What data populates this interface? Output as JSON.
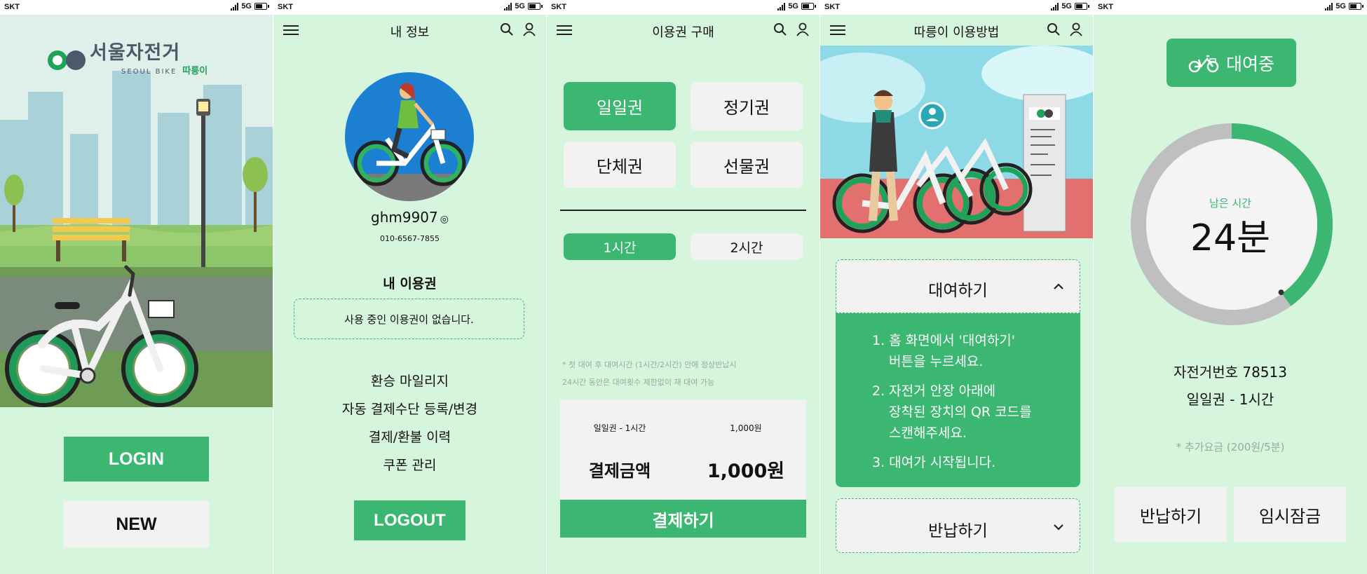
{
  "status": {
    "carrier": "SKT",
    "network": "5G"
  },
  "screen1": {
    "logo_text": "서울자전거",
    "logo_sub": "SEOUL BIKE",
    "logo_brand": "따릉이",
    "login_label": "LOGIN",
    "new_label": "NEW"
  },
  "screen2": {
    "title": "내 정보",
    "username": "ghm9907",
    "phone": "010-6567-7855",
    "pass_title": "내 이용권",
    "no_pass_text": "사용 중인 이용권이 없습니다.",
    "menu": [
      "환승 마일리지",
      "자동 결제수단 등록/변경",
      "결제/환불 이력",
      "쿠폰 관리"
    ],
    "logout_label": "LOGOUT"
  },
  "screen3": {
    "title": "이용권 구매",
    "pass_types": [
      "일일권",
      "정기권",
      "단체권",
      "선물권"
    ],
    "durations": [
      "1시간",
      "2시간"
    ],
    "notes": [
      "* 첫 대여 후 대여시간 (1시간/2시간) 안에 정상반납시",
      "24시간 동안은 대여횟수 제한없이 재 대여 가능"
    ],
    "summary_item": "일일권 - 1시간",
    "summary_price": "1,000원",
    "total_label": "결제금액",
    "total_value": "1,000원",
    "pay_label": "결제하기"
  },
  "screen4": {
    "title": "따릉이 이용방법",
    "rent_title": "대여하기",
    "steps": [
      "1. 홈 화면에서 '대여하기'",
      "버튼을 누르세요.",
      "2. 자전거 안장 아래에",
      "장착된 장치의 QR 코드를",
      "스캔해주세요.",
      "3. 대여가 시작됩니다."
    ],
    "return_title": "반납하기"
  },
  "screen5": {
    "status_label": "대여중",
    "remaining_label": "남은 시간",
    "remaining_value": "24분",
    "remaining_fraction": 0.4,
    "bike_number": "자전거번호 78513",
    "pass_info": "일일권 - 1시간",
    "extra_fee": "* 추가요금 (200원/5분)",
    "return_label": "반납하기",
    "lock_label": "임시잠금"
  },
  "colors": {
    "bg": "#d6f5dd",
    "accent": "#3cb771",
    "button_gray": "#f2f2f2"
  }
}
